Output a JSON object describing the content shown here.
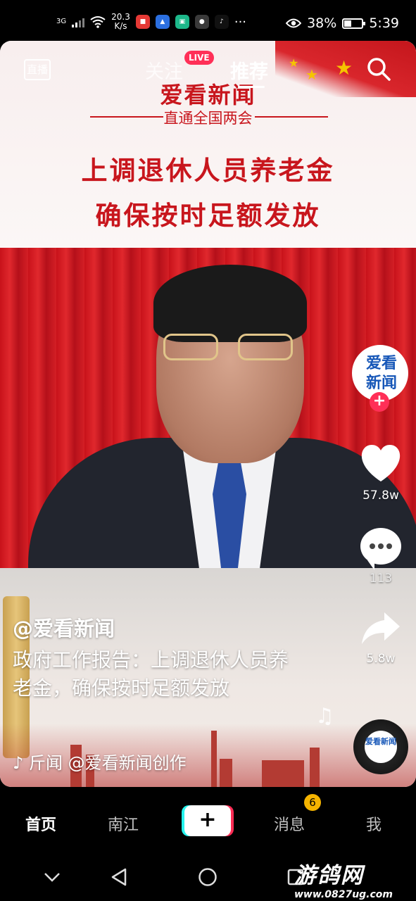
{
  "status_bar": {
    "network": "3G",
    "speed_value": "20.3",
    "speed_unit": "K/s",
    "more": "···",
    "battery": "38%",
    "time": "5:39"
  },
  "top_nav": {
    "live_label": "直播",
    "tab_follow": "关注",
    "live_badge": "LIVE",
    "tab_recommend": "推荐"
  },
  "video": {
    "brand": "爱看新闻",
    "brand_sub": "直通全国两会",
    "headline_1": "上调退休人员养老金",
    "headline_2": "确保按时足额发放"
  },
  "rail": {
    "avatar_line1": "爱看",
    "avatar_line2": "新闻",
    "likes": "57.8w",
    "comments": "113",
    "shares": "5.8w"
  },
  "caption": {
    "author": "@爱看新闻",
    "description": "政府工作报告：上调退休人员养老金，确保按时足额发放",
    "music": "♪ 斤闻   @爱看新闻创作"
  },
  "disc_text": "爱看新闻",
  "tabbar": {
    "home": "首页",
    "local": "南江",
    "plus": "+",
    "messages": "消息",
    "messages_badge": "6",
    "me": "我"
  },
  "watermark": {
    "title": "游鸽网",
    "url": "www.0827ug.com"
  }
}
